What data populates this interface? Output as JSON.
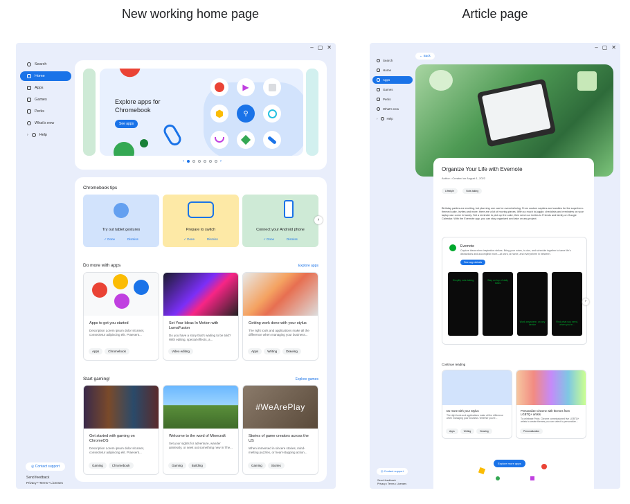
{
  "captions": {
    "left": "New working home page",
    "right": "Article page"
  },
  "window_controls": [
    "–",
    "▢",
    "✕"
  ],
  "left": {
    "sidebar": [
      {
        "label": "Search",
        "icon": "search-icon",
        "active": false
      },
      {
        "label": "Home",
        "icon": "home-icon",
        "active": true
      },
      {
        "label": "Apps",
        "icon": "apps-icon",
        "active": false
      },
      {
        "label": "Games",
        "icon": "games-icon",
        "active": false
      },
      {
        "label": "Perks",
        "icon": "perks-icon",
        "active": false
      },
      {
        "label": "What's new",
        "icon": "whats-new-icon",
        "active": false
      },
      {
        "label": "Help",
        "icon": "help-icon",
        "active": false
      }
    ],
    "hero": {
      "title": "Explore apps for Chromebook",
      "button": "See apps"
    },
    "tips": {
      "title": "Chromebook tips",
      "items": [
        {
          "label": "Try out tablet gestures",
          "done": "Done",
          "dismiss": "Dismiss",
          "color": "#d2e3fc"
        },
        {
          "label": "Prepare to switch",
          "done": "Done",
          "dismiss": "Dismiss",
          "color": "#fde9a6"
        },
        {
          "label": "Connect your Android phone",
          "done": "Done",
          "dismiss": "Dismiss",
          "color": "#ceead6"
        }
      ]
    },
    "apps": {
      "title": "Do more with apps",
      "link": "Explore apps",
      "cards": [
        {
          "title": "Apps to get you started",
          "desc": "Description Lorem ipsum dolor sit amet, consectetur adipiscing elit. Praesent...",
          "chips": [
            "Apps",
            "Chromebook"
          ]
        },
        {
          "title": "Set Your Ideas In Motion with LumaFusion",
          "desc": "Do you have a story that's waiting to be told? With editing, special effects, a...",
          "chips": [
            "Video editing"
          ]
        },
        {
          "title": "Getting work done with your stylus",
          "desc": "The right tools and applications make all the difference when managing your business...",
          "chips": [
            "Apps",
            "Writing",
            "Drawing"
          ]
        }
      ]
    },
    "games": {
      "title": "Start gaming!",
      "link": "Explore games",
      "cards": [
        {
          "title": "Get started with gaming on ChromeOS",
          "desc": "Description Lorem ipsum dolor sit amet, consectetur adipiscing elit. Praesent...",
          "chips": [
            "Gaming",
            "Chromebook"
          ]
        },
        {
          "title": "Welcome to the word of Minecraft",
          "desc": "Set your sights for adventure, wander aimlessly, or seek out something new in The...",
          "chips": [
            "Gaming",
            "Building"
          ]
        },
        {
          "title": "Stories of game creators across the US",
          "desc": "When immersed in sincere stories, mind-melting puzzles, or heart-stopping action...",
          "chips": [
            "Gaming",
            "Stories"
          ]
        }
      ]
    },
    "games_image_text": "#WeArePlay",
    "contact": "Contact support",
    "feedback": "Send feedback",
    "legal": "Privacy • Terms • Licenses"
  },
  "right": {
    "back": "Back",
    "sidebar": [
      {
        "label": "Search",
        "icon": "search-icon",
        "active": false
      },
      {
        "label": "Home",
        "icon": "home-icon",
        "active": false
      },
      {
        "label": "Apps",
        "icon": "apps-icon",
        "active": true
      },
      {
        "label": "Games",
        "icon": "games-icon",
        "active": false
      },
      {
        "label": "Perks",
        "icon": "perks-icon",
        "active": false
      },
      {
        "label": "What's new",
        "icon": "whats-new-icon",
        "active": false
      },
      {
        "label": "Help",
        "icon": "help-icon",
        "active": false
      }
    ],
    "article": {
      "title": "Organize Your Life with Evernote",
      "meta": "Author  •  Created on August 1, 2022",
      "chips": [
        "Lifestyle",
        "Note-taking"
      ],
      "body": "Birthday parties are exciting, but planning one can be overwhelming. From custom napkins and candles for the superhero-themed cake, invites and more, there are a lot of moving pieces. With so much to juggle, checklists and reminders on your laptop can come in handy. Set a reminder to pick up the cake, then send our invites to Friends and family on Google Calendar. With the Evernote app, you can stay organized and take on any project."
    },
    "app_card": {
      "name": "Evernote",
      "desc": "Capture ideas when inspiration strikes. Bring your notes, to-dos, and schedule together to tame life's distractions and accomplish more—at work, at home, and everywhere in between.",
      "button": "See app details",
      "screens": [
        "Simplify note-taking",
        "Stay on top of daily tasks",
        "Work anywhere, on any device",
        "Find what you need, when you're..."
      ]
    },
    "continue": {
      "title": "Continue reading",
      "cards": [
        {
          "title": "Do more with your Stylus",
          "desc": "The right tools and applications make all the difference when managing your business. Whether you're...",
          "chips": [
            "Apps",
            "Writing",
            "Drawing"
          ]
        },
        {
          "title": "Personalize Chrome with themes from LGBTQ+ artists",
          "desc": "To celebrate Pride, Chrome commissioned five LGBTQ+ artists to create themes you can select to personalize...",
          "chips": [
            "Personalization"
          ]
        }
      ]
    },
    "explore_button": "Explore more apps",
    "contact": "Contact support",
    "feedback": "Send feedback",
    "legal": "Privacy • Terms • Licenses"
  }
}
